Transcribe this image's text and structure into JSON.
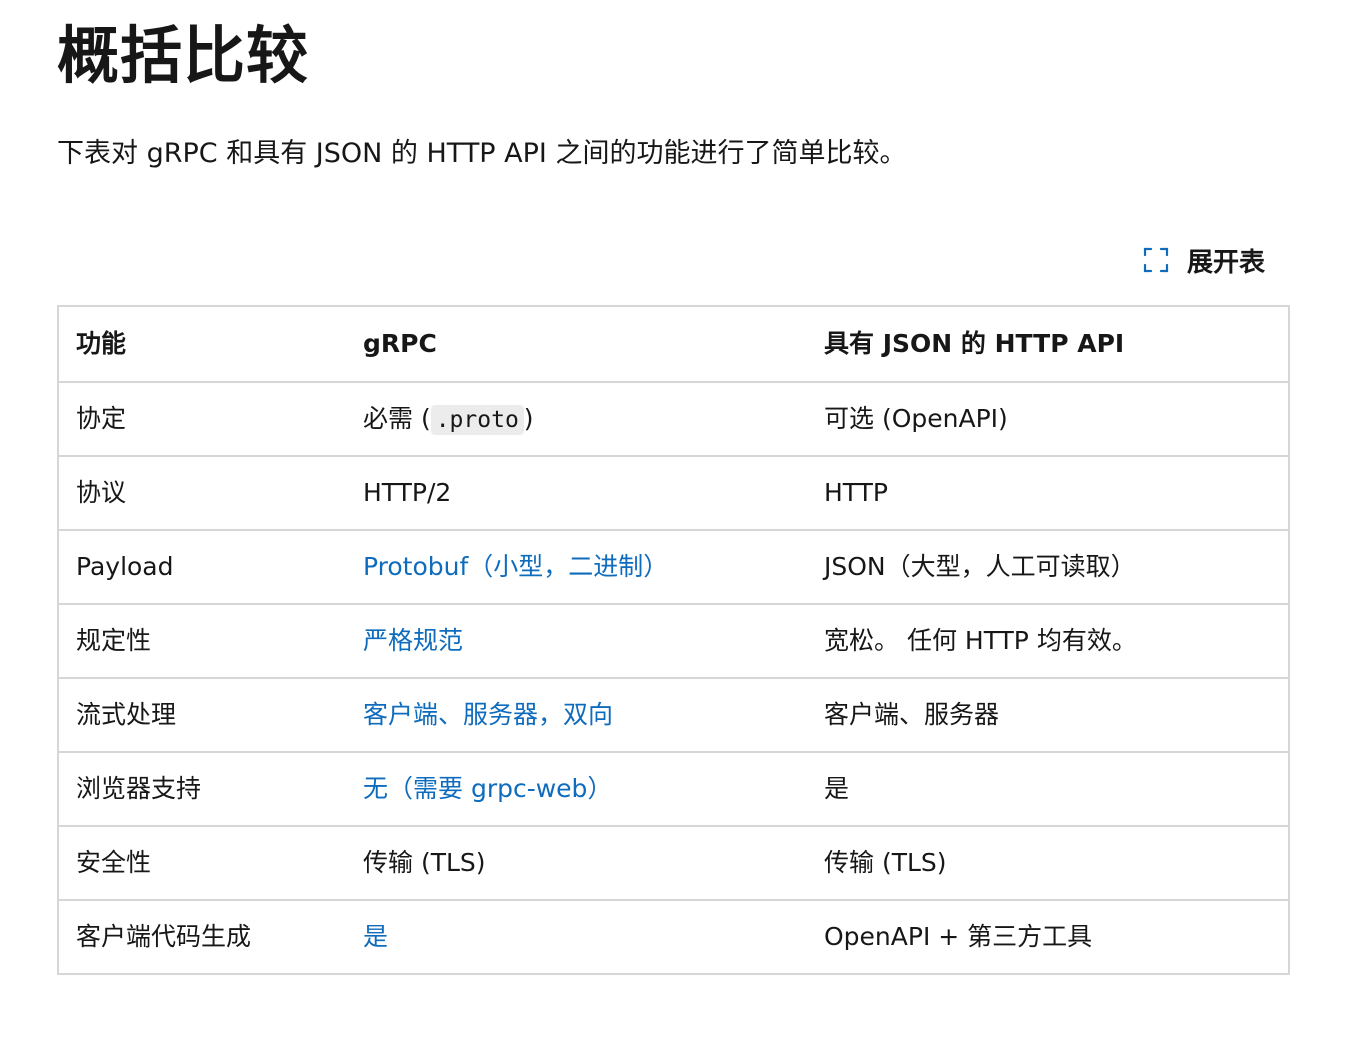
{
  "page": {
    "title": "概括比较",
    "intro": "下表对 gRPC 和具有 JSON 的 HTTP API 之间的功能进行了简单比较。"
  },
  "toolbar": {
    "expand_label": "展开表",
    "expand_icon": "expand-icon"
  },
  "colors": {
    "text": "#171717",
    "link": "#0f6cbd",
    "border": "#d6d6d6",
    "code_bg": "#ececec"
  },
  "table": {
    "headers": [
      "功能",
      "gRPC",
      "具有 JSON 的 HTTP API"
    ],
    "rows": [
      {
        "feature": "协定",
        "grpc": {
          "prefix": "必需 (",
          "code": ".proto",
          "suffix": ")"
        },
        "http": "可选 (OpenAPI)"
      },
      {
        "feature": "协议",
        "grpc": "HTTP/2",
        "http": "HTTP"
      },
      {
        "feature": "Payload",
        "grpc": "Protobuf（小型，二进制）",
        "http": "JSON（大型，人工可读取）"
      },
      {
        "feature": "规定性",
        "grpc": "严格规范",
        "http": "宽松。 任何 HTTP 均有效。"
      },
      {
        "feature": "流式处理",
        "grpc": "客户端、服务器，双向",
        "http": "客户端、服务器"
      },
      {
        "feature": "浏览器支持",
        "grpc": "无（需要 grpc-web）",
        "http": "是"
      },
      {
        "feature": "安全性",
        "grpc": "传输 (TLS)",
        "http": "传输 (TLS)"
      },
      {
        "feature": "客户端代码生成",
        "grpc": "是",
        "http": "OpenAPI + 第三方工具"
      }
    ]
  }
}
